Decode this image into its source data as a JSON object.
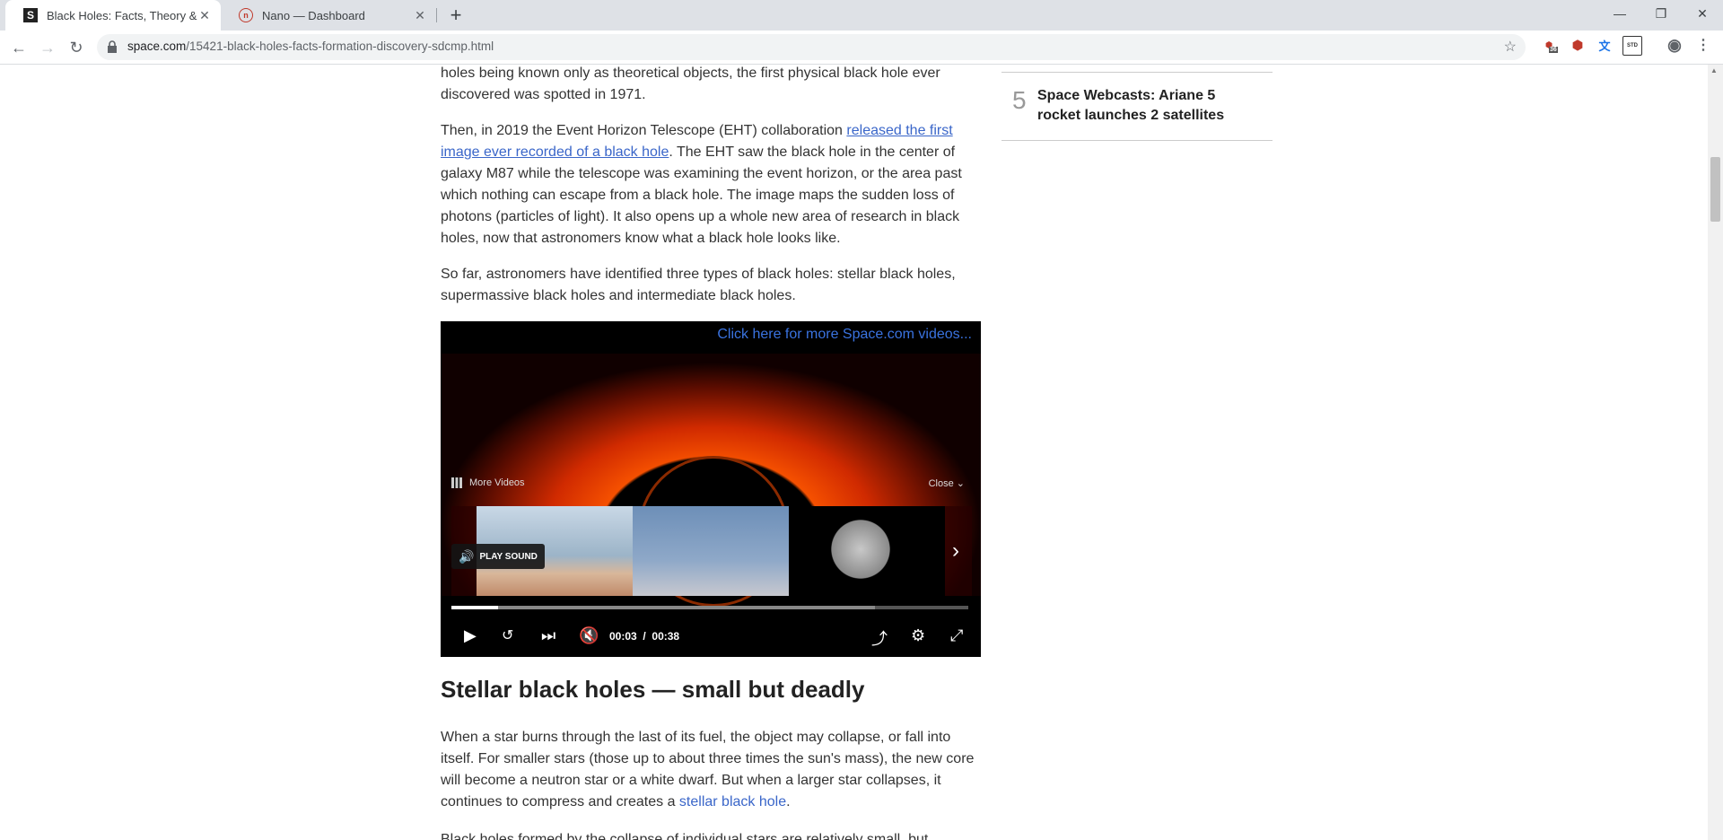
{
  "tabs": [
    {
      "title": "Black Holes: Facts, Theory & Defi",
      "favicon": "S",
      "active": true
    },
    {
      "title": "Nano — Dashboard",
      "favicon": "n",
      "active": false
    }
  ],
  "toolbar": {
    "url_host": "space.com",
    "url_path": "/15421-black-holes-facts-formation-discovery-sdcmp.html",
    "ext_badge_1": "36",
    "ext_badge_std": "STD"
  },
  "article": {
    "p1": "holes being known only as theoretical objects, the first physical black hole ever discovered was spotted in 1971.",
    "p2_before": "Then, in 2019 the Event Horizon Telescope (EHT) collaboration ",
    "p2_link": "released the first image ever recorded of a black hole",
    "p2_after": ". The EHT saw the black hole in the center of galaxy M87 while the telescope was examining the event horizon, or the area past which nothing can escape from a black hole. The image maps the sudden loss of photons (particles of light). It also opens up a whole new area of research in black holes, now that astronomers know what a black hole looks like.",
    "p3": "So far, astronomers have identified three types of black holes: stellar black holes, supermassive black holes and intermediate black holes.",
    "section_heading": "Stellar black holes — small but deadly",
    "p4_before": "When a star burns through the last of its fuel, the object may collapse, or fall into itself. For smaller stars (those up to about three times the sun's mass), the new core will become a neutron star or a white dwarf. But when a larger star collapses, it continues to compress and creates a ",
    "p4_link": "stellar black hole",
    "p4_after": ".",
    "p5": "Black holes formed by the collapse of individual stars are relatively small, but"
  },
  "video": {
    "more_link": "Click here for more Space.com videos...",
    "more_videos": "More Videos",
    "close": "Close",
    "play_sound": "PLAY SOUND",
    "current_time": "00:03",
    "separator": "/",
    "duration": "00:38",
    "progress_played": 0.09,
    "progress_loaded": 0.82
  },
  "sidebar": {
    "item_number": "5",
    "item_title": "Space Webcasts: Ariane 5 rocket launches 2 satellites"
  }
}
